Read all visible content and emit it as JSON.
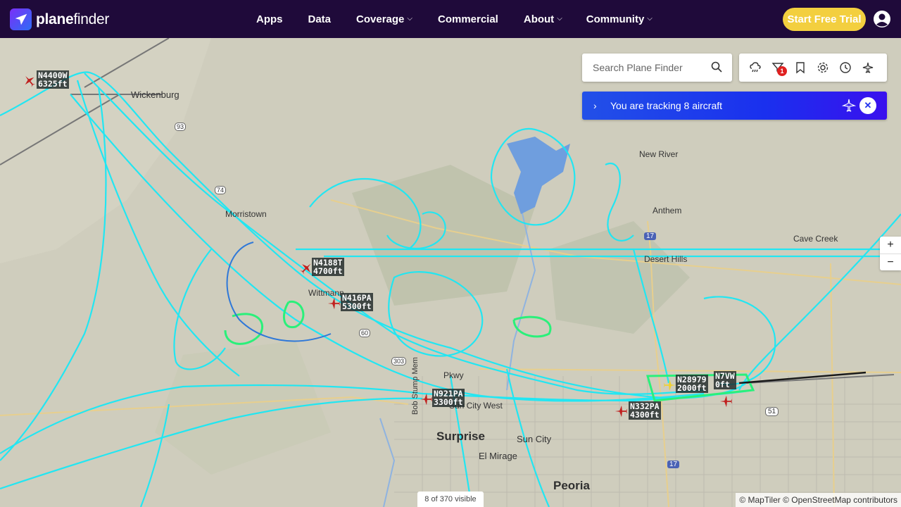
{
  "nav": {
    "logo_bold": "plane",
    "logo_rest": "finder",
    "links": [
      {
        "label": "Apps",
        "dropdown": false
      },
      {
        "label": "Data",
        "dropdown": false
      },
      {
        "label": "Coverage",
        "dropdown": true
      },
      {
        "label": "Commercial",
        "dropdown": false
      },
      {
        "label": "About",
        "dropdown": true
      },
      {
        "label": "Community",
        "dropdown": true
      }
    ],
    "trial_label": "Start Free Trial"
  },
  "search": {
    "placeholder": "Search Plane Finder"
  },
  "toolbar": {
    "filter_badge": "1"
  },
  "tracking": {
    "text": "You are tracking 8 aircraft"
  },
  "map": {
    "places": {
      "wickenburg": "Wickenburg",
      "morristown": "Morristown",
      "wittmann": "Wittmann",
      "new_river": "New River",
      "anthem": "Anthem",
      "cave_creek": "Cave Creek",
      "desert_hills": "Desert Hills",
      "surprise": "Surprise",
      "sun_city": "Sun City",
      "el_mirage": "El Mirage",
      "peoria": "Peoria",
      "sun_city_west": "Sun City West",
      "bob_stump": "Bob Stump Mem",
      "pkwy": "Pkwy"
    },
    "shields": {
      "i17_north": "17",
      "i17_south": "17",
      "r51": "51",
      "r93": "93",
      "r74": "74",
      "r60": "60",
      "r303": "303"
    },
    "aircraft": [
      {
        "reg": "N4400W",
        "alt": "6325ft"
      },
      {
        "reg": "N4188T",
        "alt": "4700ft"
      },
      {
        "reg": "N416PA",
        "alt": "5300ft"
      },
      {
        "reg": "N921PA",
        "alt": "3300ft"
      },
      {
        "reg": "N332PA",
        "alt": "4300ft"
      },
      {
        "reg": "N28979",
        "alt": "2000ft"
      },
      {
        "reg": "N7VW",
        "alt": "0ft"
      }
    ]
  },
  "zoom": {
    "in": "+",
    "out": "−"
  },
  "status": {
    "visible": "8 of 370 visible"
  },
  "attribution": "© MapTiler © OpenStreetMap contributors",
  "colors": {
    "nav_bg": "#1f0a3a",
    "trial": "#f3cf3f",
    "track": "#19e8f5",
    "track_green": "#2af07a",
    "plane": "#c0201f"
  }
}
